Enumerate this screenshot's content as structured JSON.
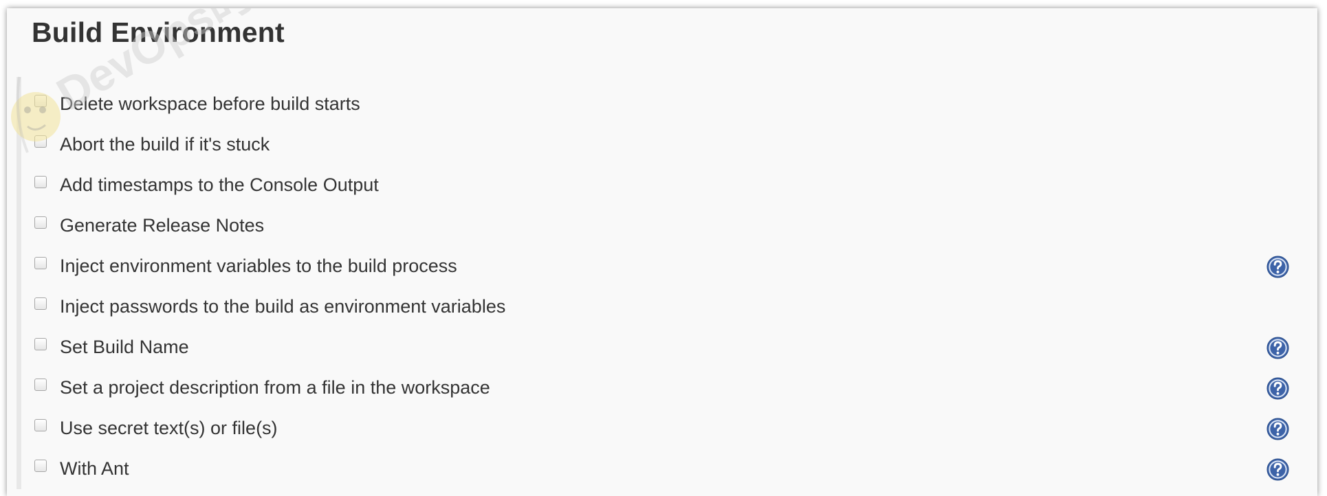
{
  "section": {
    "title": "Build Environment"
  },
  "options": [
    {
      "label": "Delete workspace before build starts",
      "checked": false,
      "has_help": false
    },
    {
      "label": "Abort the build if it's stuck",
      "checked": false,
      "has_help": false
    },
    {
      "label": "Add timestamps to the Console Output",
      "checked": false,
      "has_help": false
    },
    {
      "label": "Generate Release Notes",
      "checked": false,
      "has_help": false
    },
    {
      "label": "Inject environment variables to the build process",
      "checked": false,
      "has_help": true
    },
    {
      "label": "Inject passwords to the build as environment variables",
      "checked": false,
      "has_help": false
    },
    {
      "label": "Set Build Name",
      "checked": false,
      "has_help": true
    },
    {
      "label": "Set a project description from a file in the workspace",
      "checked": false,
      "has_help": true
    },
    {
      "label": "Use secret text(s) or file(s)",
      "checked": false,
      "has_help": true
    },
    {
      "label": "With Ant",
      "checked": false,
      "has_help": true
    }
  ],
  "icons": {
    "help": "help-question-icon",
    "watermark": "devops-watermark-logo"
  },
  "colors": {
    "panel_background": "#f9f9f9",
    "text": "#333333",
    "help_icon": "#3d63a8",
    "checkbox_border": "#a6a6a6"
  },
  "watermark": {
    "text": "DevOps时代"
  }
}
